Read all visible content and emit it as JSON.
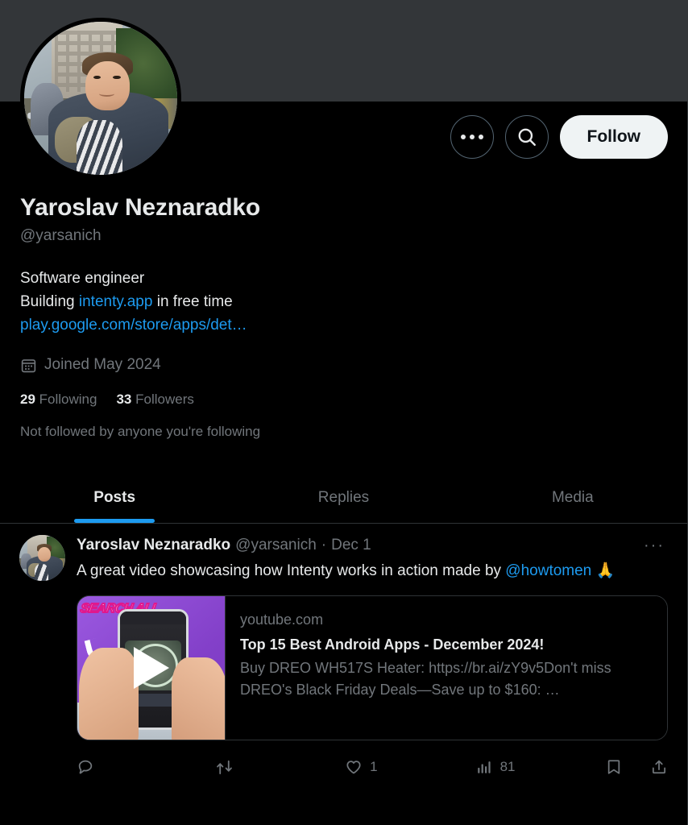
{
  "header": {
    "more_label": "More",
    "search_label": "Search",
    "follow_label": "Follow"
  },
  "profile": {
    "display_name": "Yaroslav Neznaradko",
    "handle": "@yarsanich",
    "bio_line1": "Software engineer",
    "bio_line2_prefix": "Building ",
    "bio_link": "intenty.app",
    "bio_line2_suffix": " in free time",
    "bio_url": "play.google.com/store/apps/det…",
    "joined": "Joined May 2024",
    "following_count": "29",
    "following_label": "Following",
    "followers_count": "33",
    "followers_label": "Followers",
    "not_followed": "Not followed by anyone you're following"
  },
  "tabs": [
    {
      "label": "Posts",
      "active": true
    },
    {
      "label": "Replies",
      "active": false
    },
    {
      "label": "Media",
      "active": false
    }
  ],
  "tweet": {
    "author_name": "Yaroslav Neznaradko",
    "author_handle": "@yarsanich",
    "separator": "·",
    "date": "Dec 1",
    "more_label": "···",
    "text_part1": "A great video showcasing how Intenty works in action made by ",
    "mention": "@howtomen",
    "emoji": "🙏",
    "card": {
      "domain": "youtube.com",
      "title": "Top 15 Best Android Apps - December 2024!",
      "description": "Buy DREO WH517S Heater: https://br.ai/zY9v5Don't miss DREO's Black Friday Deals—Save up to $160: …",
      "thumb_text": "SEARCH ALL"
    },
    "actions": {
      "reply_count": "",
      "retweet_count": "",
      "like_count": "1",
      "views_count": "81"
    }
  },
  "colors": {
    "accent": "#1d9bf0",
    "background": "#000000",
    "banner": "#333639",
    "text": "#e7e9ea",
    "muted": "#71767b",
    "border": "#2f3336"
  }
}
